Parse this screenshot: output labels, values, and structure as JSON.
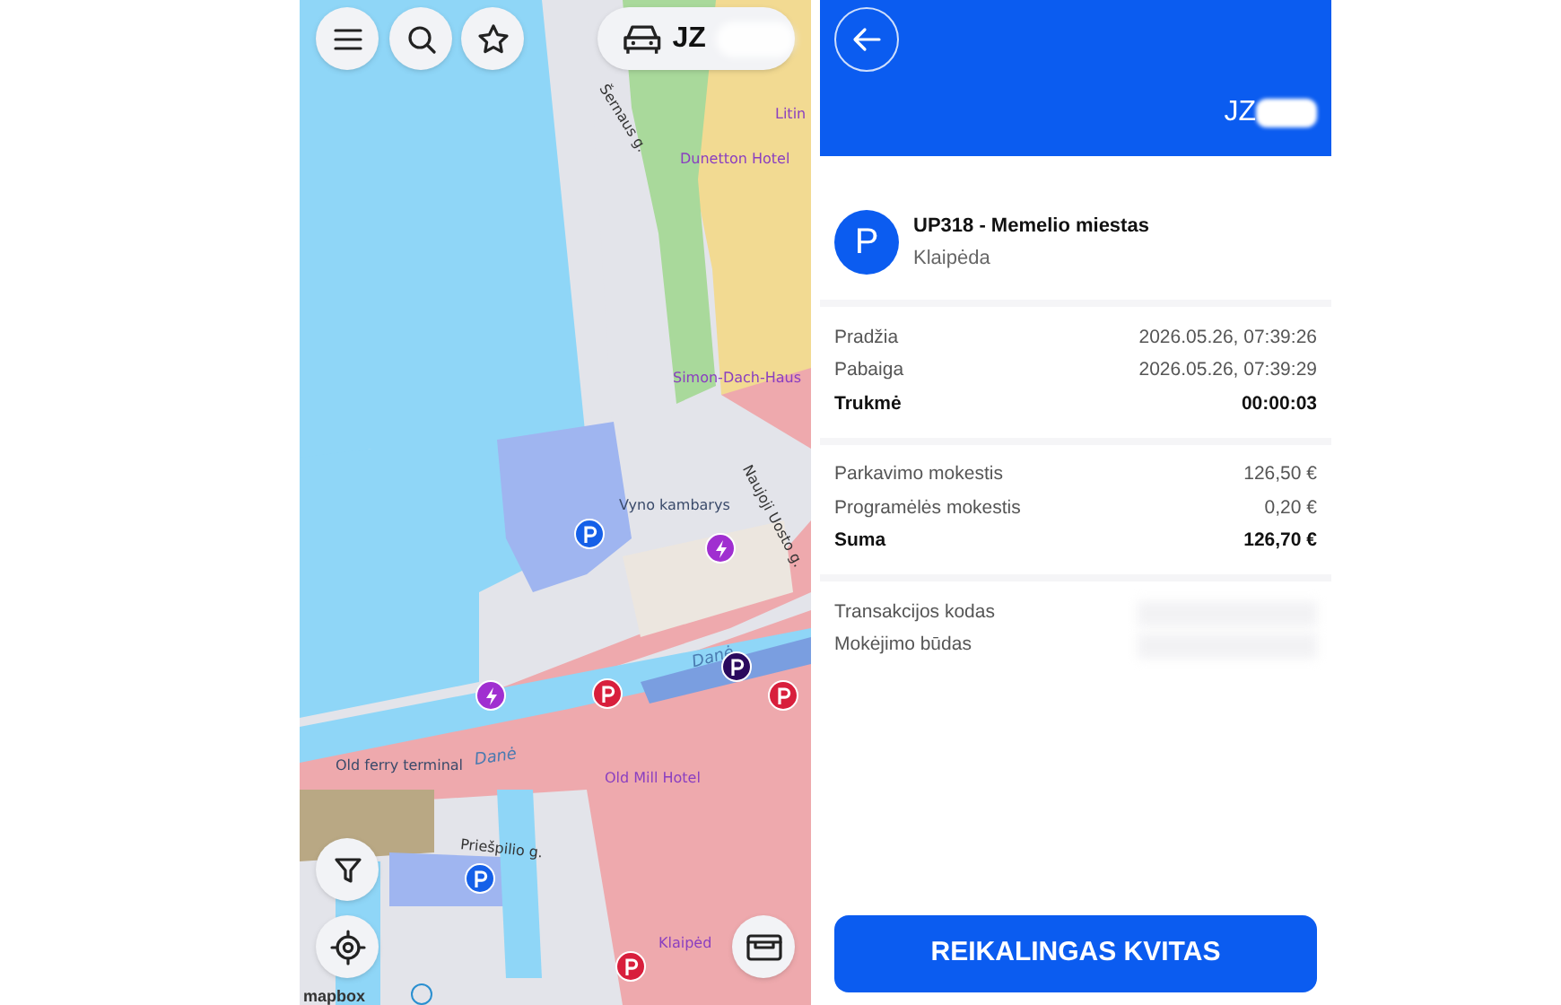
{
  "map": {
    "vehicle": {
      "plate": "JZ"
    },
    "labels": [
      {
        "text": "Šernaus g.",
        "kind": "street"
      },
      {
        "text": "Litin",
        "kind": "poi"
      },
      {
        "text": "Dunetton Hotel",
        "kind": "poi"
      },
      {
        "text": "Simon-Dach-Haus",
        "kind": "poi"
      },
      {
        "text": "Vyno kambarys",
        "kind": "place"
      },
      {
        "text": "Naujoji Uosto g.",
        "kind": "street"
      },
      {
        "text": "Danė",
        "kind": "water"
      },
      {
        "text": "Old ferry terminal",
        "kind": "place"
      },
      {
        "text": "Danė",
        "kind": "water"
      },
      {
        "text": "Old Mill Hotel",
        "kind": "poi"
      },
      {
        "text": "Priešpilio g.",
        "kind": "street"
      },
      {
        "text": "Klaipėd",
        "kind": "poi"
      }
    ],
    "markers": [
      {
        "kind": "parking",
        "color": "#1560e8"
      },
      {
        "kind": "charging",
        "color": "#a02fd0"
      },
      {
        "kind": "charging",
        "color": "#a02fd0"
      },
      {
        "kind": "parking",
        "color": "#d81f3c"
      },
      {
        "kind": "parking",
        "color": "#2a0a5e"
      },
      {
        "kind": "parking",
        "color": "#d81f3c"
      },
      {
        "kind": "parking",
        "color": "#1560e8"
      },
      {
        "kind": "parking",
        "color": "#d81f3c"
      }
    ],
    "attribution": "mapbox"
  },
  "receipt": {
    "plate": "JZ",
    "zone": {
      "icon_letter": "P",
      "title": "UP318 - Memelio miestas",
      "city": "Klaipėda"
    },
    "sections": [
      [
        {
          "label": "Pradžia",
          "value": "2026.05.26, 07:39:26",
          "kind": "normal"
        },
        {
          "label": "Pabaiga",
          "value": "2026.05.26, 07:39:29",
          "kind": "normal"
        },
        {
          "label": "Trukmė",
          "value": "00:00:03",
          "kind": "total"
        }
      ],
      [
        {
          "label": "Parkavimo mokestis",
          "value": "126,50 €",
          "kind": "normal"
        },
        {
          "label": "Programėlės mokestis",
          "value": "0,20 €",
          "kind": "normal"
        },
        {
          "label": "Suma",
          "value": "126,70 €",
          "kind": "total"
        }
      ],
      [
        {
          "label": "Transakcijos kodas",
          "kind": "hidden"
        },
        {
          "label": "Mokėjimo būdas",
          "kind": "hidden"
        }
      ]
    ],
    "button": "REIKALINGAS KVITAS"
  }
}
